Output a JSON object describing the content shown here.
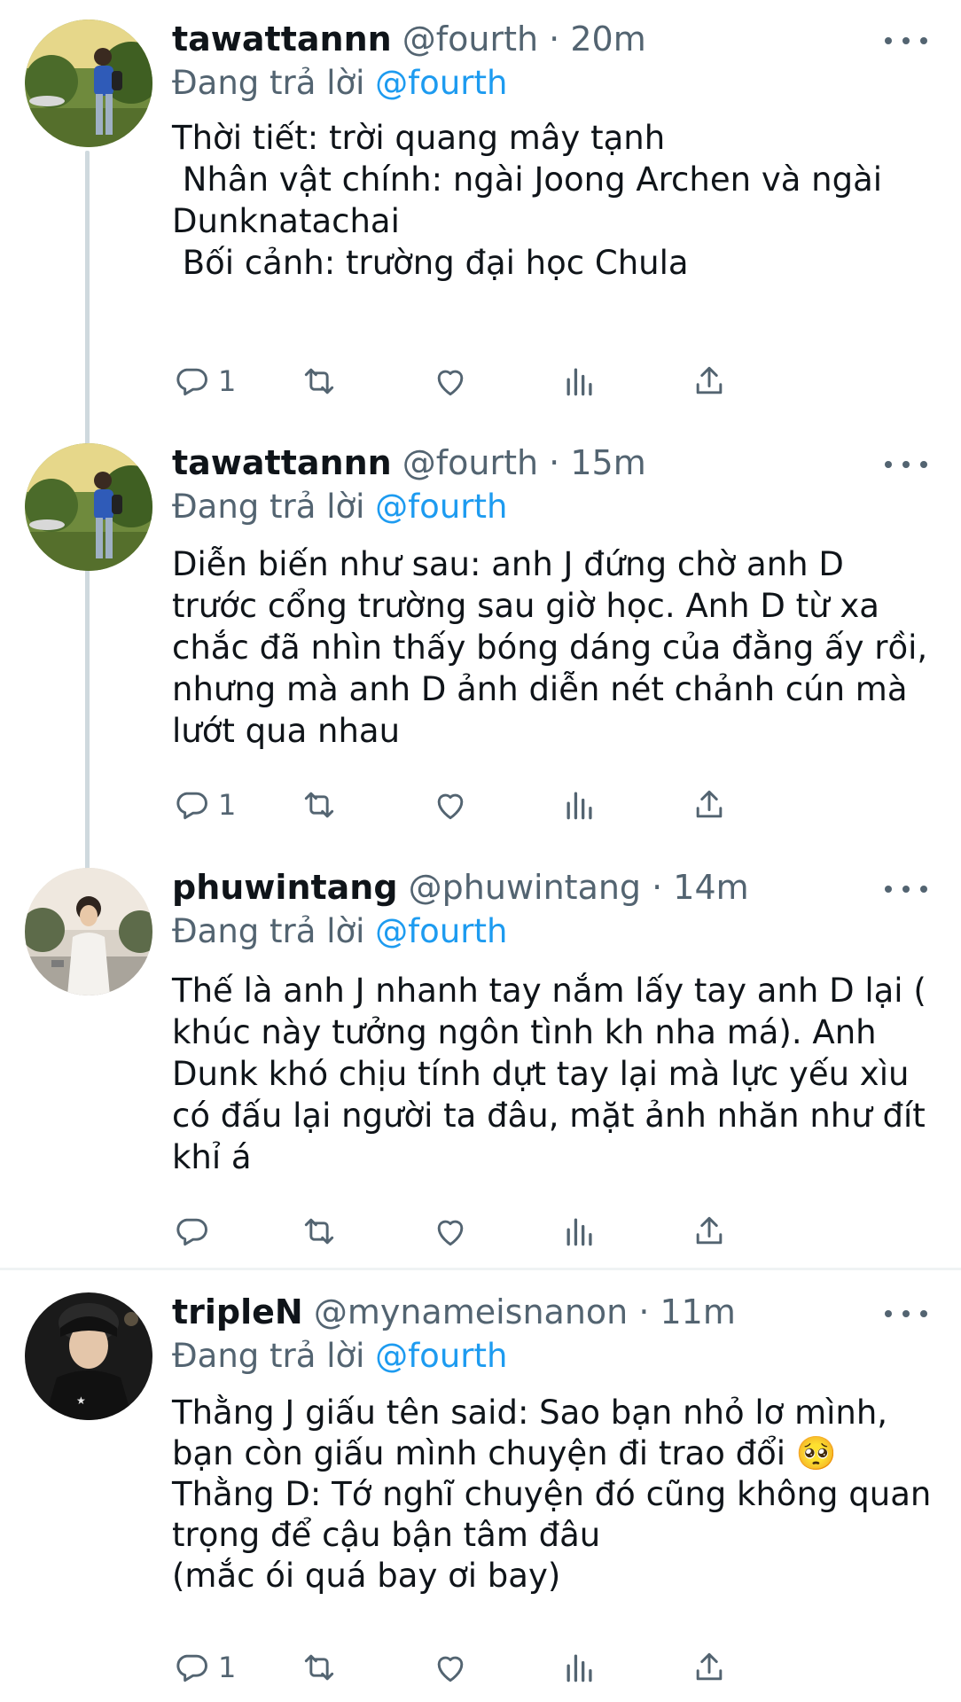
{
  "tweets": [
    {
      "name": "tawattannn",
      "meta": "@fourth · 20m",
      "reply_prefix": "Đang trả lời ",
      "reply_mention": "@fourth",
      "text": "Thời tiết: trời quang mây tạnh\n Nhân vật chính: ngài Joong Archen và ngài Dunknatachai\n Bối cảnh: trường đại học Chula",
      "reply_count": "1"
    },
    {
      "name": "tawattannn",
      "meta": "@fourth · 15m",
      "reply_prefix": "Đang trả lời ",
      "reply_mention": "@fourth",
      "text": "Diễn biến như sau: anh J đứng chờ anh D trước cổng trường sau giờ học. Anh D từ xa chắc đã nhìn thấy bóng dáng của đằng ấy rồi, nhưng mà anh D ảnh diễn nét chảnh cún mà lướt qua nhau",
      "reply_count": "1"
    },
    {
      "name": "phuwintang",
      "meta": "@phuwintang · 14m",
      "reply_prefix": "Đang trả lời ",
      "reply_mention": "@fourth",
      "text": "Thế là anh J nhanh tay nắm lấy tay anh D lại ( khúc này tưởng ngôn tình kh nha má). Anh Dunk khó chịu tính dựt tay lại mà lực yếu xìu có đấu lại người ta đâu, mặt ảnh nhăn như đít khỉ á",
      "reply_count": ""
    },
    {
      "name": "tripleN",
      "meta": "@mynameisnanon · 11m",
      "reply_prefix": "Đang trả lời ",
      "reply_mention": "@fourth",
      "text": "Thằng J giấu tên said: Sao bạn nhỏ lơ mình,\nbạn còn giấu mình chuyện đi trao đổi 🥺\nThằng D: Tớ nghĩ chuyện đó cũng không quan trọng để cậu bận tâm đâu\n(mắc ói quá bay ơi bay)",
      "reply_count": "1"
    }
  ],
  "icons": {
    "reply": "reply-icon",
    "retweet": "retweet-icon",
    "like": "heart-icon",
    "views": "views-icon",
    "share": "share-icon",
    "more": "more-icon"
  },
  "colors": {
    "text": "#0f1419",
    "secondary": "#536471",
    "accent": "#1d9bf0",
    "line": "#cfd9de"
  }
}
